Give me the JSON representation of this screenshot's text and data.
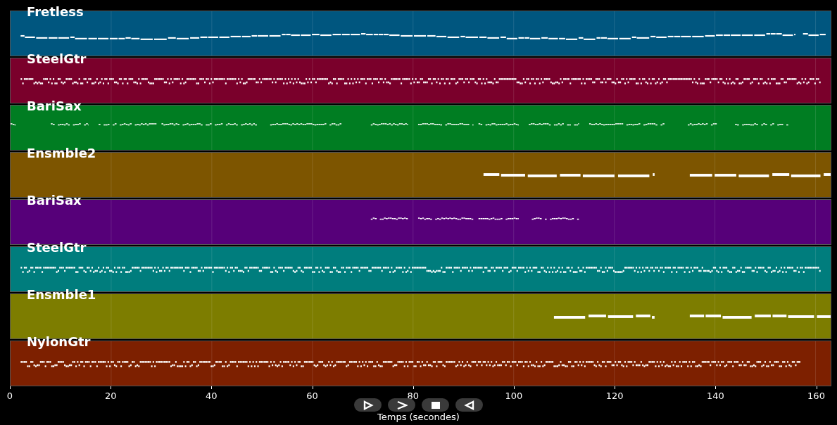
{
  "tracks": [
    {
      "name": "Fretless",
      "color": "#00567f",
      "kind": "line"
    },
    {
      "name": "SteelGtr",
      "color": "#7a002b",
      "kind": "dense"
    },
    {
      "name": "BariSax",
      "color": "#007d22",
      "kind": "sparse"
    },
    {
      "name": "Ensmble2",
      "color": "#7d5500",
      "kind": "block"
    },
    {
      "name": "BariSax",
      "color": "#560079",
      "kind": "sparse"
    },
    {
      "name": "SteelGtr",
      "color": "#007d7d",
      "kind": "dense"
    },
    {
      "name": "Ensmble1",
      "color": "#7d7d00",
      "kind": "block"
    },
    {
      "name": "NylonGtr",
      "color": "#7d2000",
      "kind": "dense"
    }
  ],
  "axis": {
    "ticks": [
      "0",
      "20",
      "40",
      "60",
      "80",
      "100",
      "120",
      "140",
      "160"
    ],
    "label": "Temps (secondes)"
  }
}
